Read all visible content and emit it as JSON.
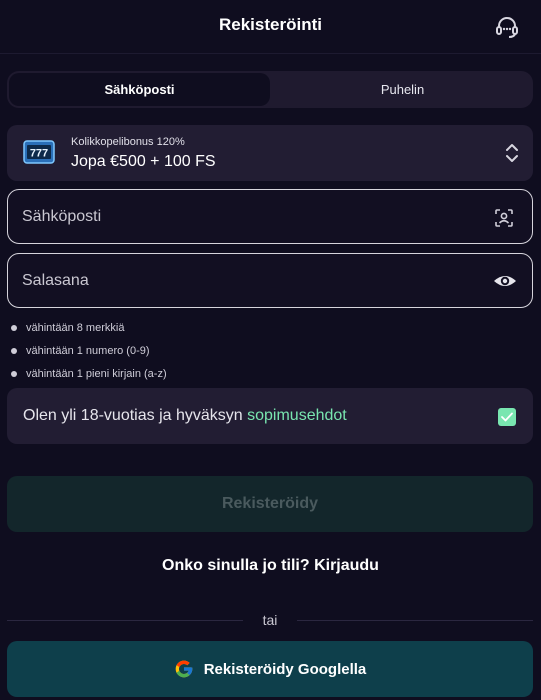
{
  "header": {
    "title": "Rekisteröinti",
    "support_icon": "headset-icon"
  },
  "tabs": [
    {
      "label": "Sähköposti",
      "active": true
    },
    {
      "label": "Puhelin",
      "active": false
    }
  ],
  "bonus": {
    "icon": "slot-machine-777-icon",
    "label": "Kolikkopelibonus 120%",
    "value": "Jopa €500 + 100 FS"
  },
  "email_field": {
    "placeholder": "Sähköposti",
    "value": "",
    "icon": "contact-scan-icon"
  },
  "password_field": {
    "placeholder": "Salasana",
    "value": "",
    "icon": "eye-icon"
  },
  "password_rules": [
    "vähintään 8 merkkiä",
    "vähintään 1 numero (0-9)",
    "vähintään 1 pieni kirjain (a-z)"
  ],
  "terms": {
    "text": "Olen yli 18-vuotias ja hyväksyn ",
    "link": "sopimusehdot",
    "checked": true
  },
  "register_button": "Rekisteröidy",
  "login_prompt": {
    "text": "Onko sinulla jo tili? ",
    "link": "Kirjaudu"
  },
  "divider_text": "tai",
  "google_button": {
    "label": "Rekisteröidy Googlella",
    "icon": "google-icon"
  },
  "colors": {
    "background": "#0f0d1f",
    "accent_green": "#79e6b0",
    "google_button": "#0e3f4b",
    "register_disabled": "#13262b"
  }
}
